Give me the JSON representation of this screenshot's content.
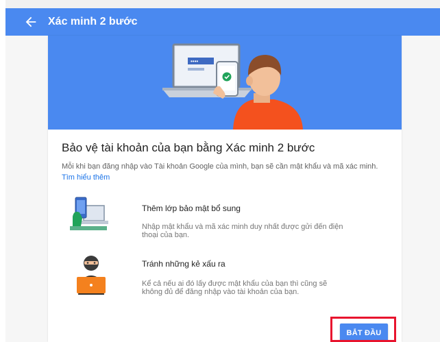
{
  "header": {
    "title": "Xác minh 2 bước",
    "back_icon": "arrow-back-icon"
  },
  "card": {
    "hero_illustration": "laptop-phone-person-illustration",
    "title": "Bảo vệ tài khoản của bạn bằng Xác minh 2 bước",
    "description": "Mỗi khi bạn đăng nhập vào Tài khoản Google của mình, bạn sẽ cần mật khẩu và mã xác minh.",
    "learn_more": "Tìm hiểu thêm",
    "features": [
      {
        "icon": "phone-laptop-security-icon",
        "title": "Thêm lớp bảo mật bổ sung",
        "description": "Nhập mật khẩu và mã xác minh duy nhất được gửi đến điện thoại của bạn."
      },
      {
        "icon": "hacker-laptop-icon",
        "title": "Tránh những kẻ xấu ra",
        "description": "Kể cả nếu ai đó lấy được mật khẩu của bạn thì cũng sẽ không đủ để đăng nhập vào tài khoản của bạn."
      }
    ],
    "start_button": "BẮT ĐẦU"
  },
  "colors": {
    "primary_blue": "#4a89f0",
    "highlight_red": "#e8142e",
    "link_blue": "#1a73e8",
    "person_orange": "#f4511e"
  }
}
